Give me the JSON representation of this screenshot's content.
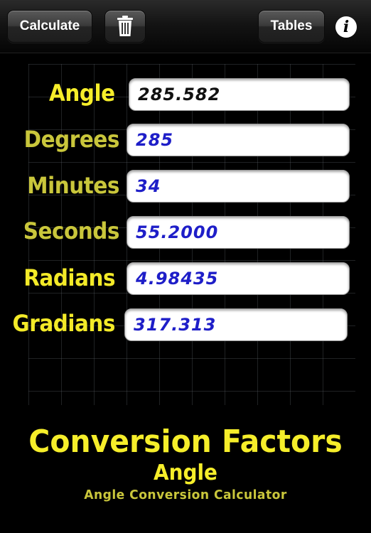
{
  "toolbar": {
    "calculate_label": "Calculate",
    "tables_label": "Tables",
    "info_label": "i",
    "trash_icon": "trash-icon"
  },
  "fields": {
    "angle": {
      "label": "Angle",
      "value": "285.582"
    },
    "degrees": {
      "label": "Degrees",
      "value": "285"
    },
    "minutes": {
      "label": "Minutes",
      "value": "34"
    },
    "seconds": {
      "label": "Seconds",
      "value": "55.2000"
    },
    "radians": {
      "label": "Radians",
      "value": "4.98435"
    },
    "gradians": {
      "label": "Gradians",
      "value": "317.313"
    }
  },
  "footer": {
    "title": "Conversion Factors",
    "subtitle": "Angle",
    "caption": "Angle Conversion Calculator"
  },
  "colors": {
    "label_yellow": "#f6ee2a",
    "label_olive": "#c9c63b",
    "value_blue": "#1e1ec8",
    "background": "#000000"
  }
}
